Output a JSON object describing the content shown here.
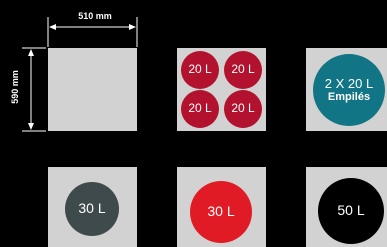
{
  "colors": {
    "background": "#000000",
    "tile": "#d2d2d2",
    "dimension_line": "#ffffff",
    "dimension_text": "#ffffff",
    "bin_20l": "#b3122e",
    "bin_stacked": "#127585",
    "bin_30l_dark": "#3f4a4c",
    "bin_30l_red": "#e11b26",
    "bin_50l": "#000000",
    "disc_text": "#ffffff"
  },
  "dimensions": {
    "width_label": "510 mm",
    "height_label": "590 mm"
  },
  "tiles": [
    {
      "name": "empty",
      "discs": []
    },
    {
      "name": "four-20l",
      "discs": [
        {
          "label": "20 L",
          "color": "#b3122e"
        },
        {
          "label": "20 L",
          "color": "#b3122e"
        },
        {
          "label": "20 L",
          "color": "#b3122e"
        },
        {
          "label": "20 L",
          "color": "#b3122e"
        }
      ]
    },
    {
      "name": "stacked-20l",
      "discs": [
        {
          "line1": "2 X 20 L",
          "line2": "Empilés",
          "color": "#127585"
        }
      ]
    },
    {
      "name": "30l-dark",
      "discs": [
        {
          "label": "30 L",
          "color": "#3f4a4c"
        }
      ]
    },
    {
      "name": "30l-red",
      "discs": [
        {
          "label": "30 L",
          "color": "#e11b26"
        }
      ]
    },
    {
      "name": "50l",
      "discs": [
        {
          "label": "50 L",
          "color": "#000000"
        }
      ]
    }
  ]
}
